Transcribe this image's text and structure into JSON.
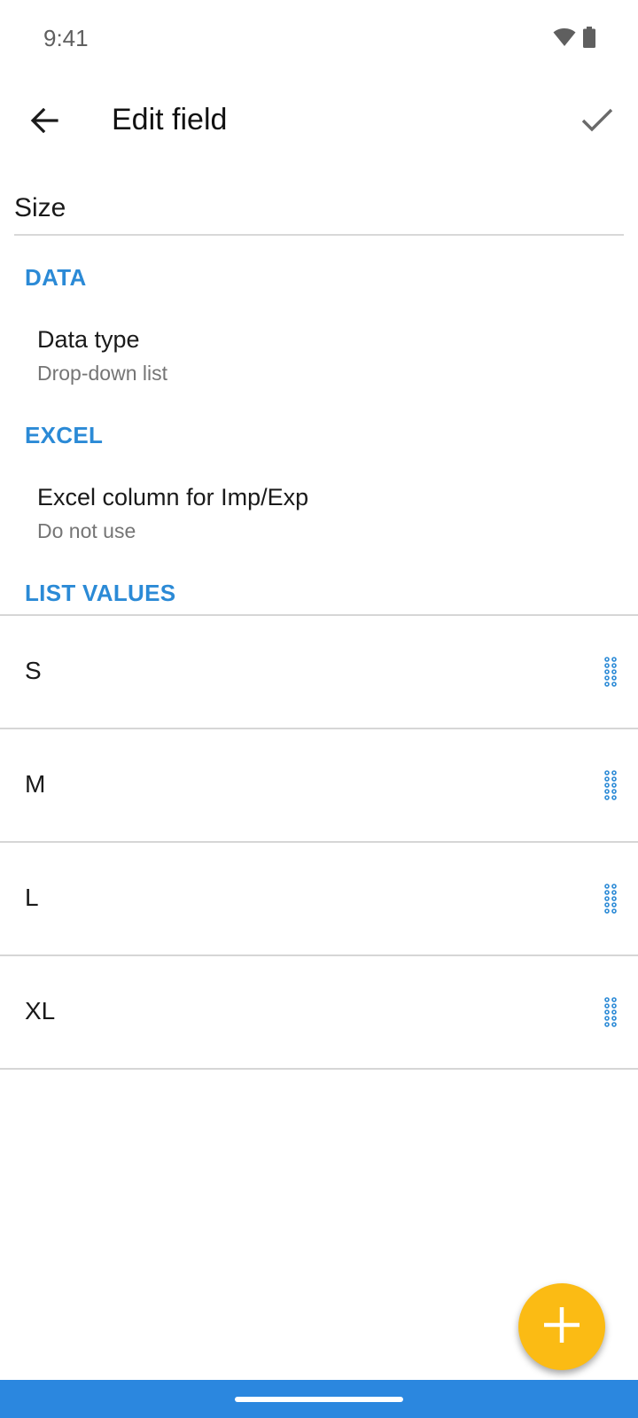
{
  "status_bar": {
    "time": "9:41",
    "icons": [
      "wifi-icon",
      "battery-icon"
    ]
  },
  "app_bar": {
    "title": "Edit field",
    "back_icon": "arrow-back-icon",
    "confirm_icon": "check-icon"
  },
  "field": {
    "name_value": "Size"
  },
  "sections": {
    "data": {
      "header": "DATA",
      "item_title": "Data type",
      "item_summary": "Drop-down list"
    },
    "excel": {
      "header": "EXCEL",
      "item_title": "Excel column for Imp/Exp",
      "item_summary": "Do not use"
    },
    "list_values": {
      "header": "LIST VALUES",
      "items": [
        {
          "label": "S"
        },
        {
          "label": "M"
        },
        {
          "label": "L"
        },
        {
          "label": "XL"
        }
      ]
    }
  },
  "fab": {
    "icon": "plus-icon"
  },
  "colors": {
    "accent": "#2b8ad6",
    "fab": "#fbbb14",
    "nav_bar": "#2b87df"
  }
}
